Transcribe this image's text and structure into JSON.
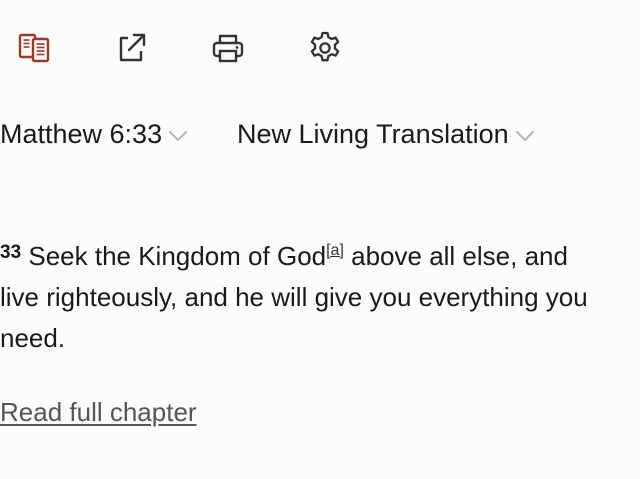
{
  "toolbar": {
    "icons": [
      "parallel-view-icon",
      "share-icon",
      "print-icon",
      "gear-icon"
    ],
    "accent_color": "#9a3c22",
    "icon_color": "#333333"
  },
  "selectors": {
    "passage": "Matthew 6:33",
    "version": "New Living Translation"
  },
  "passage": {
    "verse_number": "33",
    "line1_before_note": " Seek the Kingdom of God",
    "footnote": "[a]",
    "line1_after_note": " above all else, and",
    "line2": "live righteously, and he will give you everything you",
    "line3": "need."
  },
  "links": {
    "read_full_chapter": "Read full chapter"
  }
}
